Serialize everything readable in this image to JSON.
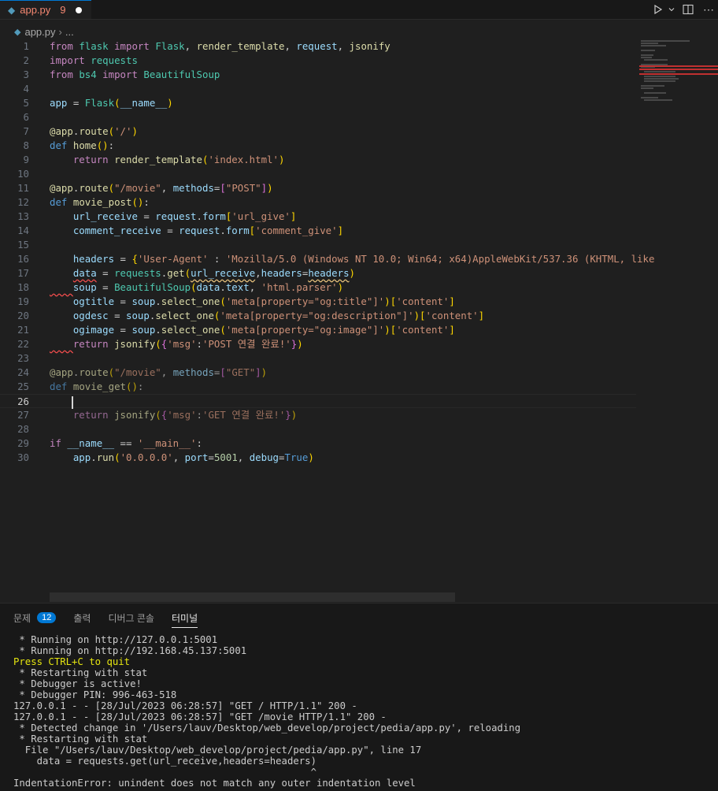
{
  "tab": {
    "filename": "app.py",
    "error_count": "9"
  },
  "breadcrumb": {
    "file": "app.py",
    "rest": "..."
  },
  "editor": {
    "active_line": 26,
    "line_numbers": [
      "1",
      "2",
      "3",
      "4",
      "5",
      "6",
      "7",
      "8",
      "9",
      "10",
      "11",
      "12",
      "13",
      "14",
      "15",
      "16",
      "17",
      "18",
      "19",
      "20",
      "21",
      "22",
      "23",
      "24",
      "25",
      "26",
      "27",
      "28",
      "29",
      "30"
    ]
  },
  "code": {
    "l1": [
      "from",
      "flask",
      "import",
      "Flask",
      "render_template",
      "request",
      "jsonify"
    ],
    "l2": [
      "import",
      "requests"
    ],
    "l3": [
      "from",
      "bs4",
      "import",
      "BeautifulSoup"
    ],
    "l5": [
      "app",
      "Flask",
      "__name__"
    ],
    "l7": [
      "@app",
      "route",
      "'/'"
    ],
    "l8": [
      "def",
      "home"
    ],
    "l9": [
      "return",
      "render_template",
      "'index.html'"
    ],
    "l11": [
      "@app",
      "route",
      "\"/movie\"",
      "methods",
      "\"POST\""
    ],
    "l12": [
      "def",
      "movie_post"
    ],
    "l13": [
      "url_receive",
      "request",
      "form",
      "'url_give'"
    ],
    "l14": [
      "comment_receive",
      "request",
      "form",
      "'comment_give'"
    ],
    "l16": [
      "headers",
      "'User-Agent'",
      "'Mozilla/5.0 (Windows NT 10.0; Win64; x64)AppleWebKit/537.36 (KHTML, like"
    ],
    "l17": [
      "data",
      "requests",
      "get",
      "url_receive",
      "headers",
      "headers"
    ],
    "l18": [
      "soup",
      "BeautifulSoup",
      "data",
      "text",
      "'html.parser'"
    ],
    "l19": [
      "ogtitle",
      "soup",
      "select_one",
      "'meta[property=\"og:title\"]'",
      "'content'"
    ],
    "l20": [
      "ogdesc",
      "soup",
      "select_one",
      "'meta[property=\"og:description\"]'",
      "'content'"
    ],
    "l21": [
      "ogimage",
      "soup",
      "select_one",
      "'meta[property=\"og:image\"]'",
      "'content'"
    ],
    "l22": [
      "return",
      "jsonify",
      "'msg'",
      "'POST 연결 완료!'"
    ],
    "l24": [
      "@app",
      "route",
      "\"/movie\"",
      "methods",
      "\"GET\""
    ],
    "l25": [
      "def",
      "movie_get"
    ],
    "l27": [
      "return",
      "jsonify",
      "'msg'",
      "'GET 연결 완료!'"
    ],
    "l29": [
      "if",
      "__name__",
      "'__main__'"
    ],
    "l30": [
      "app",
      "run",
      "'0.0.0.0'",
      "port",
      "5001",
      "debug",
      "True"
    ]
  },
  "panel": {
    "tabs": [
      "문제",
      "출력",
      "디버그 콘솔",
      "터미널"
    ],
    "problems_count": "12",
    "active_tab": "터미널"
  },
  "terminal": {
    "lines": [
      " * Running on http://127.0.0.1:5001",
      " * Running on http://192.168.45.137:5001",
      "Press CTRL+C to quit",
      " * Restarting with stat",
      " * Debugger is active!",
      " * Debugger PIN: 996-463-518",
      "127.0.0.1 - - [28/Jul/2023 06:28:57] \"GET / HTTP/1.1\" 200 -",
      "127.0.0.1 - - [28/Jul/2023 06:28:57] \"GET /movie HTTP/1.1\" 200 -",
      " * Detected change in '/Users/lauv/Desktop/web_develop/project/pedia/app.py', reloading",
      " * Restarting with stat",
      "  File \"/Users/lauv/Desktop/web_develop/project/pedia/app.py\", line 17",
      "    data = requests.get(url_receive,headers=headers)",
      "                                                   ^",
      "IndentationError: unindent does not match any outer indentation level"
    ]
  }
}
